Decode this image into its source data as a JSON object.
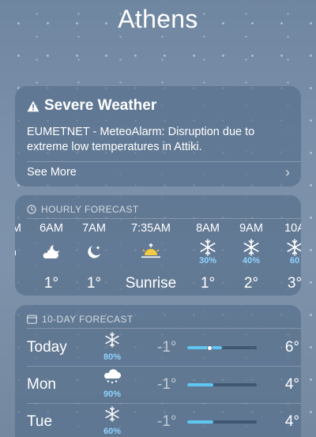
{
  "city": "Athens",
  "alert": {
    "title": "Severe Weather",
    "body": "EUMETNET - MeteoAlarm: Disruption due to extreme low temperatures in Attiki.",
    "see_more": "See More"
  },
  "hourly": {
    "title": "HOURLY FORECAST",
    "items": [
      {
        "time": "M",
        "icon": "partly-cloudy-night-icon",
        "precip": "",
        "temp": ""
      },
      {
        "time": "6AM",
        "icon": "partly-cloudy-night-icon",
        "precip": "",
        "temp": "1°"
      },
      {
        "time": "7AM",
        "icon": "partly-cloudy-night-icon",
        "precip": "",
        "temp": "1°"
      },
      {
        "time": "7:35AM",
        "icon": "sunrise-icon",
        "precip": "",
        "temp": "Sunrise"
      },
      {
        "time": "8AM",
        "icon": "snowflake-icon",
        "precip": "30%",
        "temp": "1°"
      },
      {
        "time": "9AM",
        "icon": "snowflake-icon",
        "precip": "40%",
        "temp": "2°"
      },
      {
        "time": "10A",
        "icon": "snowflake-icon",
        "precip": "60",
        "temp": "3°"
      }
    ]
  },
  "daily": {
    "title": "10-DAY FORECAST",
    "days": [
      {
        "day": "Today",
        "icon": "snowflake-icon",
        "precip": "80%",
        "low": "-1°",
        "high": "6°",
        "range_start": 0.0,
        "range_end": 0.5,
        "current": 0.32
      },
      {
        "day": "Mon",
        "icon": "snow-cloud-icon",
        "precip": "90%",
        "low": "-1°",
        "high": "4°",
        "range_start": 0.0,
        "range_end": 0.38
      },
      {
        "day": "Tue",
        "icon": "snowflake-icon",
        "precip": "60%",
        "low": "-1°",
        "high": "4°",
        "range_start": 0.0,
        "range_end": 0.38
      }
    ]
  }
}
